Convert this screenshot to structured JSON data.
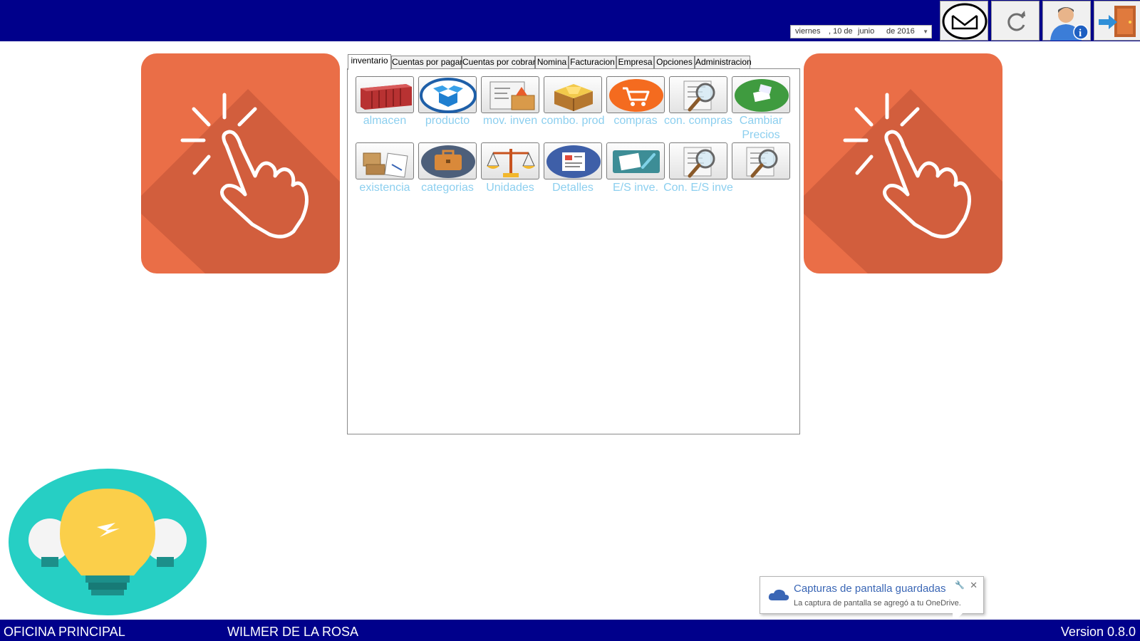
{
  "header": {
    "date": {
      "weekday": "viernes",
      "day": ", 10 de",
      "month": "junio",
      "year": "de 2016"
    },
    "buttons": [
      {
        "name": "mail-button",
        "icon": "envelope-icon"
      },
      {
        "name": "refresh-button",
        "icon": "refresh-icon"
      },
      {
        "name": "user-info-button",
        "icon": "user-info-icon"
      },
      {
        "name": "exit-button",
        "icon": "exit-door-icon"
      }
    ]
  },
  "tabs": [
    {
      "label": "inventario",
      "active": true
    },
    {
      "label": "Cuentas por pagar"
    },
    {
      "label": "Cuentas por cobrar"
    },
    {
      "label": "Nomina"
    },
    {
      "label": "Facturacion"
    },
    {
      "label": "Empresa"
    },
    {
      "label": "Opciones"
    },
    {
      "label": "Administracion"
    }
  ],
  "inventory_items": [
    {
      "label": "almacen",
      "icon": "container-icon"
    },
    {
      "label": "producto",
      "icon": "open-box-icon"
    },
    {
      "label": "mov. inven",
      "icon": "document-box-icon"
    },
    {
      "label": "combo. prod",
      "icon": "cardboard-box-icon"
    },
    {
      "label": "compras",
      "icon": "shopping-cart-icon"
    },
    {
      "label": "con. compras",
      "icon": "magnifier-document-icon"
    },
    {
      "label": "Cambiar",
      "label2": "Precios",
      "icon": "money-icon"
    },
    {
      "label": "existencia",
      "icon": "pallet-icon"
    },
    {
      "label": "categorias",
      "icon": "briefcase-icon"
    },
    {
      "label": "Unidades",
      "icon": "balance-scale-icon"
    },
    {
      "label": "Detalles",
      "icon": "detail-document-icon"
    },
    {
      "label": "E/S inve.",
      "icon": "edit-card-icon"
    },
    {
      "label": "Con. E/S inve",
      "icon": "magnifier-document-icon"
    },
    {
      "label": "",
      "icon": "magnifier-document-icon"
    }
  ],
  "toast": {
    "title": "Capturas de pantalla guardadas",
    "body": "La captura de pantalla se agregó a tu OneDrive.",
    "close": "✕",
    "pin": "🔧"
  },
  "status": {
    "office": "OFICINA PRINCIPAL",
    "user": "WILMER DE LA ROSA",
    "version": "Version 0.8.0"
  },
  "colors": {
    "navy": "#00008b",
    "tile_orange": "#ea6e47",
    "label_blue": "#8ccfef",
    "bulb_teal": "#26cfc4",
    "bulb_yellow": "#fbcf4a"
  }
}
